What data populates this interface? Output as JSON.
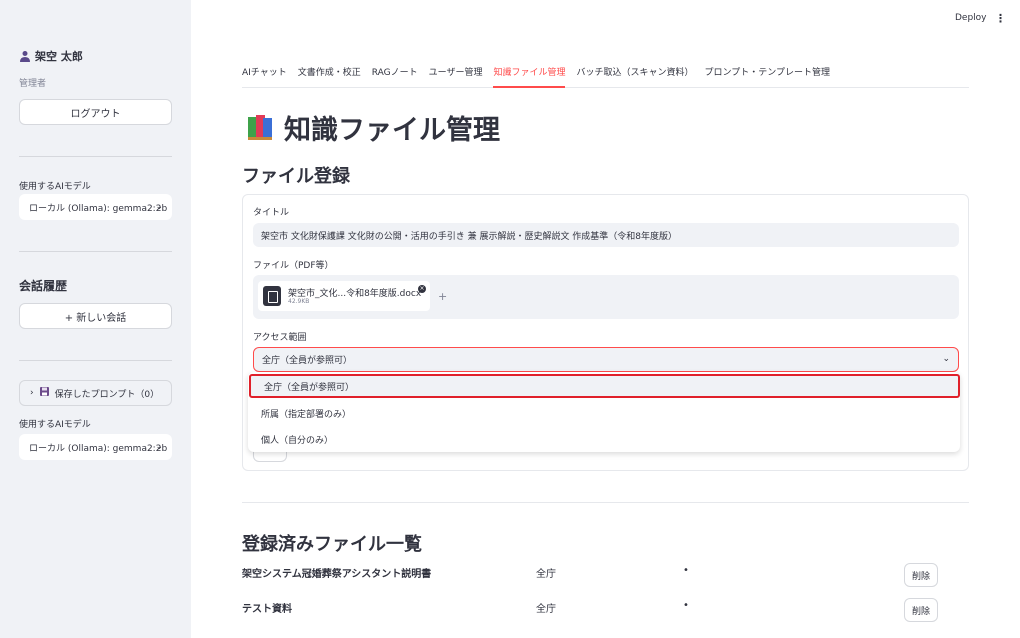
{
  "sidebar": {
    "user_name": "架空 太郎",
    "user_role": "管理者",
    "logout_label": "ログアウト",
    "model_label": "使用するAIモデル",
    "model_value": "ローカル (Ollama): gemma2:2b",
    "history_heading": "会話履歴",
    "new_chat_label": "+ 新しい会話",
    "saved_prompts_label": "保存したプロンプト（0）",
    "model_label_2": "使用するAIモデル",
    "model_value_2": "ローカル (Ollama): gemma2:2b"
  },
  "topbar": {
    "deploy_label": "Deploy"
  },
  "tabs": [
    {
      "label": "AIチャット"
    },
    {
      "label": "文書作成・校正"
    },
    {
      "label": "RAGノート"
    },
    {
      "label": "ユーザー管理"
    },
    {
      "label": "知識ファイル管理",
      "active": true
    },
    {
      "label": "バッチ取込（スキャン資料）"
    },
    {
      "label": "プロンプト・テンプレート管理"
    }
  ],
  "main": {
    "page_title": "知識ファイル管理",
    "register_heading": "ファイル登録",
    "title_label": "タイトル",
    "title_value": "架空市 文化財保護課 文化財の公開・活用の手引き 兼 展示解説・歴史解説文 作成基準（令和8年度版）",
    "file_label": "ファイル（PDF等）",
    "file_name": "架空市_文化...令和8年度版.docx",
    "file_size": "42.9KB",
    "access_label": "アクセス範囲",
    "access_value": "全庁（全員が参照可）",
    "access_options": [
      "全庁（全員が参照可）",
      "所属（指定部署のみ）",
      "個人（自分のみ）"
    ],
    "list_heading": "登録済みファイル一覧",
    "files": [
      {
        "name": "架空システム冠婚葬祭アシスタント説明書",
        "access": "全庁",
        "dot": "•",
        "delete_label": "削除"
      },
      {
        "name": "テスト資料",
        "access": "全庁",
        "dot": "•",
        "delete_label": "削除"
      }
    ]
  },
  "colors": {
    "accent": "#ff4b4b",
    "highlight_border": "#e0202a",
    "sidebar_bg": "#f0f2f6"
  }
}
